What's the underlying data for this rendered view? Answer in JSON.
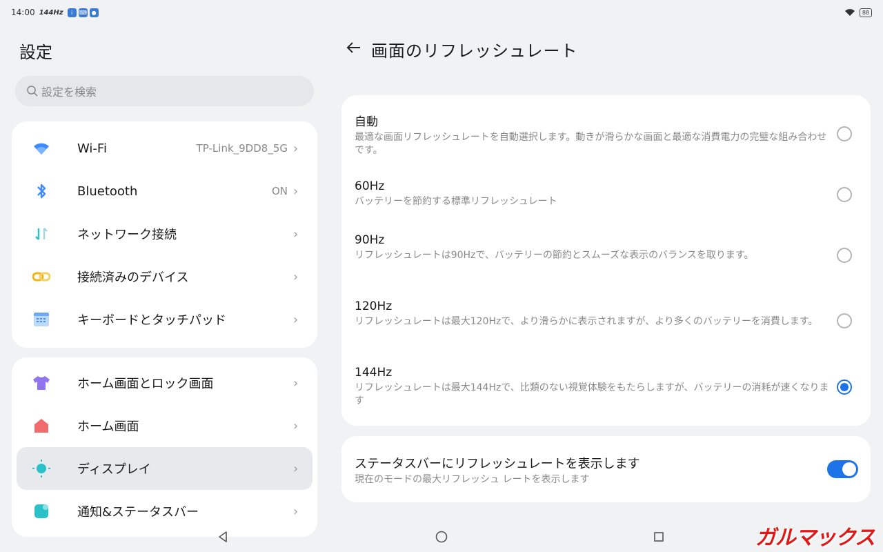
{
  "status_bar": {
    "time": "14:00",
    "refresh": "144Hz",
    "battery": "88",
    "icons": [
      "info-icon",
      "keyboard-icon",
      "mic-icon"
    ]
  },
  "left": {
    "title": "設定",
    "search_placeholder": "設定を検索",
    "group1": [
      {
        "label": "Wi-Fi",
        "value": "TP-Link_9DD8_5G",
        "icon": "wifi-icon"
      },
      {
        "label": "Bluetooth",
        "value": "ON",
        "icon": "bluetooth-icon"
      },
      {
        "label": "ネットワーク接続",
        "value": "",
        "icon": "network-icon"
      },
      {
        "label": "接続済みのデバイス",
        "value": "",
        "icon": "link-icon"
      },
      {
        "label": "キーボードとタッチパッド",
        "value": "",
        "icon": "keyboard-icon"
      }
    ],
    "group2": [
      {
        "label": "ホーム画面とロック画面",
        "icon": "theme-shirt-icon"
      },
      {
        "label": "ホーム画面",
        "icon": "home-icon"
      },
      {
        "label": "ディスプレイ",
        "icon": "sun-icon"
      },
      {
        "label": "通知&ステータスバー",
        "icon": "notification-icon"
      }
    ]
  },
  "right": {
    "title": "画面のリフレッシュレート",
    "options": [
      {
        "title": "自動",
        "desc": "最適な画面リフレッシュレートを自動選択します。動きが滑らかな画面と最適な消費電力の完璧な組み合わせです。",
        "selected": false
      },
      {
        "title": "60Hz",
        "desc": "バッテリーを節約する標準リフレッシュレート",
        "selected": false
      },
      {
        "title": "90Hz",
        "desc": "リフレッシュレートは90Hzで、バッテリーの節約とスムーズな表示のバランスを取ります。",
        "selected": false
      },
      {
        "title": "120Hz",
        "desc": "リフレッシュレートは最大120Hzで、より滑らかに表示されますが、より多くのバッテリーを消費します。",
        "selected": false
      },
      {
        "title": "144Hz",
        "desc": "リフレッシュレートは最大144Hzで、比類のない視覚体験をもたらしますが、バッテリーの消耗が速くなります",
        "selected": true
      }
    ],
    "toggle": {
      "title": "ステータスバーにリフレッシュレートを表示します",
      "desc": "現在のモードの最大リフレッシュ レートを表示します",
      "on": true
    }
  },
  "watermark": "ガルマックス",
  "colors": {
    "accent": "#1e73e8",
    "background": "#f1f2f4",
    "card": "#ffffff"
  }
}
